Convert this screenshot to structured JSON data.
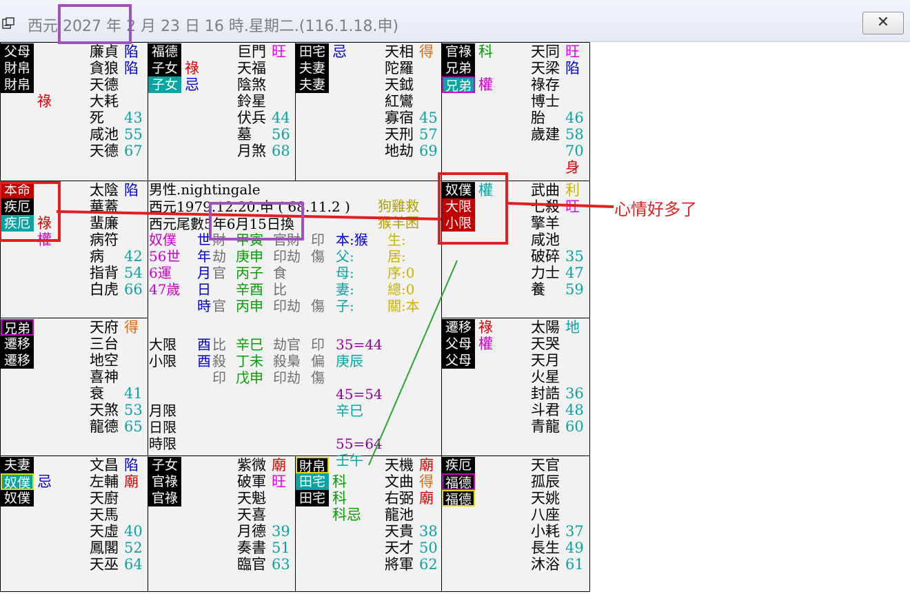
{
  "window": {
    "title": "西元 2027 年 2 月 23 日 16 時.星期二.(116.1.18.申)",
    "close_label": "✕"
  },
  "colors": {
    "black": "#000000",
    "red": "#dd0000",
    "blue": "#0000cc",
    "teal": "#0aa3a3",
    "magenta": "#cc00cc",
    "green": "#00a000",
    "orange": "#ee6600",
    "olive": "#b0a000",
    "gold": "#c8b400",
    "grey": "#707070"
  },
  "palaces": [
    {
      "name": "top-1",
      "tags": [
        {
          "t": "父母",
          "s": "bk"
        },
        {
          "t": "財帛",
          "s": "bk"
        },
        {
          "t": "財帛",
          "s": "bk"
        }
      ],
      "side": [
        {
          "t": "",
          "c": ""
        },
        {
          "t": "",
          "c": ""
        },
        {
          "t": "",
          "c": ""
        },
        {
          "t": "祿",
          "c": "#dd0000"
        }
      ],
      "stars": [
        {
          "n": "廉貞",
          "m": "陷",
          "mc": "#0000cc"
        },
        {
          "n": "貪狼",
          "m": "陷",
          "mc": "#0000cc"
        },
        {
          "n": "天德",
          "m": "",
          "mc": ""
        },
        {
          "n": "大耗",
          "m": "",
          "mc": ""
        },
        {
          "n": "死",
          "m": "43",
          "mc": "#0aa3a3"
        },
        {
          "n": "咸池",
          "m": "55",
          "mc": "#0aa3a3"
        },
        {
          "n": "天德",
          "m": "67",
          "mc": "#0aa3a3"
        }
      ]
    },
    {
      "name": "top-2",
      "tags": [
        {
          "t": "福德",
          "s": "bk"
        },
        {
          "t": "子女",
          "s": "bk"
        },
        {
          "t": "子女",
          "s": "tl"
        }
      ],
      "side": [
        {
          "t": "",
          "c": ""
        },
        {
          "t": "祿",
          "c": "#dd0000"
        },
        {
          "t": "忌",
          "c": "#0000cc"
        }
      ],
      "stars": [
        {
          "n": "巨門",
          "m": "旺",
          "mc": "#ee00ee"
        },
        {
          "n": "天福",
          "m": "",
          "mc": ""
        },
        {
          "n": "陰煞",
          "m": "",
          "mc": ""
        },
        {
          "n": "鈴星",
          "m": "",
          "mc": ""
        },
        {
          "n": "伏兵",
          "m": "44",
          "mc": "#0aa3a3"
        },
        {
          "n": "墓",
          "m": "56",
          "mc": "#0aa3a3"
        },
        {
          "n": "月煞",
          "m": "68",
          "mc": "#0aa3a3"
        }
      ]
    },
    {
      "name": "top-3",
      "tags": [
        {
          "t": "田宅",
          "s": "bk"
        },
        {
          "t": "夫妻",
          "s": "bk"
        },
        {
          "t": "夫妻",
          "s": "bk"
        }
      ],
      "side": [
        {
          "t": "忌",
          "c": "#0000cc"
        }
      ],
      "stars": [
        {
          "n": "天相",
          "m": "得",
          "mc": "#ee6600"
        },
        {
          "n": "陀羅",
          "m": "",
          "mc": ""
        },
        {
          "n": "天鉞",
          "m": "",
          "mc": ""
        },
        {
          "n": "紅鸞",
          "m": "",
          "mc": ""
        },
        {
          "n": "寡宿",
          "m": "45",
          "mc": "#0aa3a3"
        },
        {
          "n": "天刑",
          "m": "57",
          "mc": "#0aa3a3"
        },
        {
          "n": "地劫",
          "m": "69",
          "mc": "#0aa3a3"
        }
      ]
    },
    {
      "name": "top-4",
      "tags": [
        {
          "t": "官祿",
          "s": "bk"
        },
        {
          "t": "兄弟",
          "s": "bk"
        },
        {
          "t": "兄弟",
          "s": "tl mgb"
        }
      ],
      "side": [
        {
          "t": "科",
          "c": "#00a000"
        },
        {
          "t": "",
          "c": ""
        },
        {
          "t": "權",
          "c": "#cc00cc"
        }
      ],
      "stars": [
        {
          "n": "天同",
          "m": "旺",
          "mc": "#ee00ee"
        },
        {
          "n": "天梁",
          "m": "陷",
          "mc": "#0000cc"
        },
        {
          "n": "祿存",
          "m": "",
          "mc": ""
        },
        {
          "n": "博士",
          "m": "",
          "mc": ""
        },
        {
          "n": "胎",
          "m": "46",
          "mc": "#0aa3a3"
        },
        {
          "n": "歲建",
          "m": "58",
          "mc": "#0aa3a3"
        },
        {
          "n": "",
          "m": "70",
          "mc": "#0aa3a3"
        },
        {
          "n": "",
          "m": "身",
          "mc": "#dd0000"
        }
      ]
    },
    {
      "name": "left-2",
      "tags": [
        {
          "t": "本命",
          "s": "rd"
        },
        {
          "t": "疾厄",
          "s": "bk"
        },
        {
          "t": "疾厄",
          "s": "tl"
        }
      ],
      "side": [
        {
          "t": "",
          "c": ""
        },
        {
          "t": "",
          "c": ""
        },
        {
          "t": "祿",
          "c": "#dd0000"
        },
        {
          "t": "權",
          "c": "#cc00cc"
        }
      ],
      "stars": [
        {
          "n": "太陰",
          "m": "陷",
          "mc": "#0000cc"
        },
        {
          "n": "華蓋",
          "m": "",
          "mc": ""
        },
        {
          "n": "蜚廉",
          "m": "",
          "mc": ""
        },
        {
          "n": "病符",
          "m": "",
          "mc": ""
        },
        {
          "n": "病",
          "m": "42",
          "mc": "#0aa3a3"
        },
        {
          "n": "指背",
          "m": "54",
          "mc": "#0aa3a3"
        },
        {
          "n": "白虎",
          "m": "66",
          "mc": "#0aa3a3"
        }
      ]
    },
    {
      "name": "right-2",
      "tags": [
        {
          "t": "奴僕",
          "s": "bk"
        },
        {
          "t": "大限",
          "s": "rd"
        },
        {
          "t": "小限",
          "s": "rd"
        }
      ],
      "side": [
        {
          "t": "權",
          "c": "#0aa3a3"
        }
      ],
      "stars": [
        {
          "n": "武曲",
          "m": "利",
          "mc": "#c8b400"
        },
        {
          "n": "七殺",
          "m": "旺",
          "mc": "#ee00ee"
        },
        {
          "n": "擎羊",
          "m": "",
          "mc": ""
        },
        {
          "n": "咸池",
          "m": "",
          "mc": ""
        },
        {
          "n": "破碎",
          "m": "35",
          "mc": "#0aa3a3"
        },
        {
          "n": "力士",
          "m": "47",
          "mc": "#0aa3a3"
        },
        {
          "n": "養",
          "m": "59",
          "mc": "#0aa3a3"
        }
      ]
    },
    {
      "name": "left-3",
      "tags": [
        {
          "t": "兄弟",
          "s": "bk mgb"
        },
        {
          "t": "遷移",
          "s": "bk"
        },
        {
          "t": "遷移",
          "s": "bk"
        }
      ],
      "side": [],
      "stars": [
        {
          "n": "天府",
          "m": "得",
          "mc": "#ee6600"
        },
        {
          "n": "三台",
          "m": "",
          "mc": ""
        },
        {
          "n": "地空",
          "m": "",
          "mc": ""
        },
        {
          "n": "喜神",
          "m": "",
          "mc": ""
        },
        {
          "n": "衰",
          "m": "41",
          "mc": "#0aa3a3"
        },
        {
          "n": "天煞",
          "m": "53",
          "mc": "#0aa3a3"
        },
        {
          "n": "龍德",
          "m": "65",
          "mc": "#0aa3a3"
        }
      ]
    },
    {
      "name": "right-3",
      "tags": [
        {
          "t": "遷移",
          "s": "bk"
        },
        {
          "t": "父母",
          "s": "bk"
        },
        {
          "t": "父母",
          "s": "bk"
        }
      ],
      "side": [
        {
          "t": "祿",
          "c": "#dd0000"
        },
        {
          "t": "權",
          "c": "#cc00cc"
        }
      ],
      "stars": [
        {
          "n": "太陽",
          "m": "地",
          "mc": "#0aa3a3"
        },
        {
          "n": "天哭",
          "m": "",
          "mc": ""
        },
        {
          "n": "天月",
          "m": "",
          "mc": ""
        },
        {
          "n": "火星",
          "m": "",
          "mc": ""
        },
        {
          "n": "封誥",
          "m": "36",
          "mc": "#0aa3a3"
        },
        {
          "n": "斗君",
          "m": "48",
          "mc": "#0aa3a3"
        },
        {
          "n": "青龍",
          "m": "60",
          "mc": "#0aa3a3"
        }
      ]
    },
    {
      "name": "bottom-1",
      "tags": [
        {
          "t": "夫妻",
          "s": "bk"
        },
        {
          "t": "奴僕",
          "s": "tl yeb"
        },
        {
          "t": "奴僕",
          "s": "bk"
        }
      ],
      "side": [
        {
          "t": "",
          "c": ""
        },
        {
          "t": "忌",
          "c": "#0000cc"
        }
      ],
      "stars": [
        {
          "n": "文昌",
          "m": "陷",
          "mc": "#0000cc"
        },
        {
          "n": "左輔",
          "m": "廟",
          "mc": "#dd0000"
        },
        {
          "n": "天廚",
          "m": "",
          "mc": ""
        },
        {
          "n": "天馬",
          "m": "",
          "mc": ""
        },
        {
          "n": "天虛",
          "m": "40",
          "mc": "#0aa3a3"
        },
        {
          "n": "鳳閣",
          "m": "52",
          "mc": "#0aa3a3"
        },
        {
          "n": "天巫",
          "m": "64",
          "mc": "#0aa3a3"
        }
      ]
    },
    {
      "name": "bottom-2",
      "tags": [
        {
          "t": "子女",
          "s": "bk"
        },
        {
          "t": "官祿",
          "s": "bk"
        },
        {
          "t": "官祿",
          "s": "bk"
        }
      ],
      "side": [],
      "stars": [
        {
          "n": "紫微",
          "m": "廟",
          "mc": "#dd0000"
        },
        {
          "n": "破軍",
          "m": "旺",
          "mc": "#ee00ee"
        },
        {
          "n": "天魁",
          "m": "",
          "mc": ""
        },
        {
          "n": "天喜",
          "m": "",
          "mc": ""
        },
        {
          "n": "月德",
          "m": "39",
          "mc": "#0aa3a3"
        },
        {
          "n": "奏書",
          "m": "51",
          "mc": "#0aa3a3"
        },
        {
          "n": "臨官",
          "m": "63",
          "mc": "#0aa3a3"
        }
      ]
    },
    {
      "name": "bottom-3",
      "tags": [
        {
          "t": "財帛",
          "s": "bk yeb"
        },
        {
          "t": "田宅",
          "s": "tl"
        },
        {
          "t": "田宅",
          "s": "bk"
        }
      ],
      "side": [
        {
          "t": "",
          "c": ""
        },
        {
          "t": "科",
          "c": "#00a000"
        },
        {
          "t": "科",
          "c": "#00a000"
        },
        {
          "t": "科忌",
          "c": "#00a000"
        }
      ],
      "stars": [
        {
          "n": "天機",
          "m": "廟",
          "mc": "#dd0000"
        },
        {
          "n": "文曲",
          "m": "得",
          "mc": "#ee6600"
        },
        {
          "n": "右弼",
          "m": "廟",
          "mc": "#dd0000"
        },
        {
          "n": "龍池",
          "m": "",
          "mc": ""
        },
        {
          "n": "天貴",
          "m": "38",
          "mc": "#0aa3a3"
        },
        {
          "n": "天才",
          "m": "50",
          "mc": "#0aa3a3"
        },
        {
          "n": "將軍",
          "m": "62",
          "mc": "#0aa3a3"
        }
      ]
    },
    {
      "name": "bottom-4",
      "tags": [
        {
          "t": "疾厄",
          "s": "bk"
        },
        {
          "t": "福德",
          "s": "bk mgb"
        },
        {
          "t": "福德",
          "s": "bk yeb"
        }
      ],
      "side": [],
      "stars": [
        {
          "n": "天官",
          "m": "",
          "mc": ""
        },
        {
          "n": "孤辰",
          "m": "",
          "mc": ""
        },
        {
          "n": "天姚",
          "m": "",
          "mc": ""
        },
        {
          "n": "八座",
          "m": "",
          "mc": ""
        },
        {
          "n": "小耗",
          "m": "37",
          "mc": "#0aa3a3"
        },
        {
          "n": "長生",
          "m": "49",
          "mc": "#0aa3a3"
        },
        {
          "n": "沐浴",
          "m": "61",
          "mc": "#0aa3a3"
        }
      ]
    }
  ],
  "center": {
    "line1": "男性.nightingale",
    "line1_right": "狗雞救",
    "line2": "西元1979.12.20.申 ( 68.11.2 )",
    "line3": "西元尾數5年6月15日換",
    "line3_right": "猴羊困",
    "grid": [
      {
        "a": "奴僕",
        "b": "世",
        "c": "財",
        "d": "甲寅",
        "e": "官財",
        "f": "印",
        "g": "本:猴",
        "h": "生:"
      },
      {
        "a": "56世",
        "b": "年",
        "c": "劫",
        "d": "庚申",
        "e": "印劫",
        "f": "傷",
        "g": "父:",
        "h": "居:"
      },
      {
        "a": "6運",
        "b": "月",
        "c": "官",
        "d": "丙子",
        "e": "食",
        "f": "",
        "g": "母:",
        "h": "序:0"
      },
      {
        "a": "47歲",
        "b": "日",
        "c": "",
        "d": "辛酉",
        "e": "比",
        "f": "",
        "g": "妻:",
        "h": "總:0"
      },
      {
        "a": "",
        "b": "時",
        "c": "官",
        "d": "丙申",
        "e": "印劫",
        "f": "傷",
        "g": "子:",
        "h": "關:本"
      }
    ],
    "lower": [
      {
        "a": "大限",
        "b": "酉",
        "c": "比",
        "d": "辛巳",
        "e": "劫官",
        "f": "印",
        "g": "35=44"
      },
      {
        "a": "小限",
        "b": "酉",
        "c": "殺",
        "d": "丁未",
        "e": "殺梟",
        "f": "偏",
        "g": "庚辰"
      },
      {
        "a": "",
        "b": "",
        "c": "印",
        "d": "戊申",
        "e": "印劫",
        "f": "傷",
        "g": ""
      },
      {
        "a": "",
        "b": "",
        "c": "",
        "d": "",
        "e": "",
        "f": "",
        "g": "45=54"
      },
      {
        "a": "月限",
        "b": "",
        "c": "",
        "d": "",
        "e": "",
        "f": "",
        "g": "辛巳"
      },
      {
        "a": "日限",
        "b": "",
        "c": "",
        "d": "",
        "e": "",
        "f": "",
        "g": ""
      },
      {
        "a": "時限",
        "b": "",
        "c": "",
        "d": "",
        "e": "",
        "f": "",
        "g": "55=64"
      },
      {
        "a": "",
        "b": "",
        "c": "",
        "d": "",
        "e": "",
        "f": "",
        "g": "壬午"
      }
    ]
  },
  "annotation": {
    "text": "心情好多了"
  }
}
